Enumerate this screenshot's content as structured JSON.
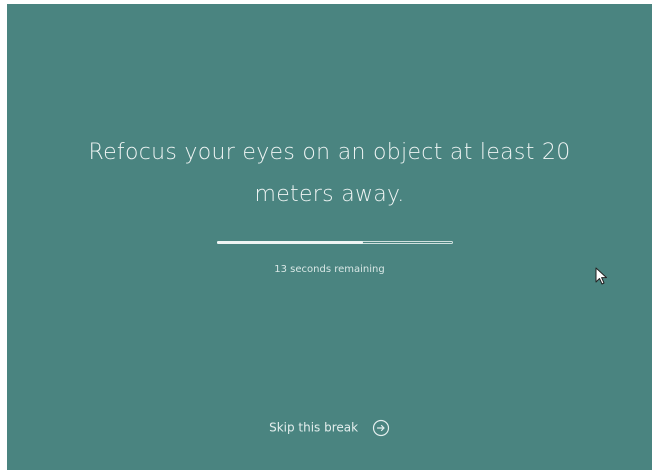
{
  "break_screen": {
    "message": "Refocus your eyes on an object at least 20 meters away.",
    "progress_fraction": 0.62,
    "remaining_text": "13 seconds remaining",
    "skip_label": "Skip this break",
    "skip_icon": "arrow-right-circle-icon"
  },
  "colors": {
    "background": "#4a8480",
    "text": "#eef4f3"
  }
}
